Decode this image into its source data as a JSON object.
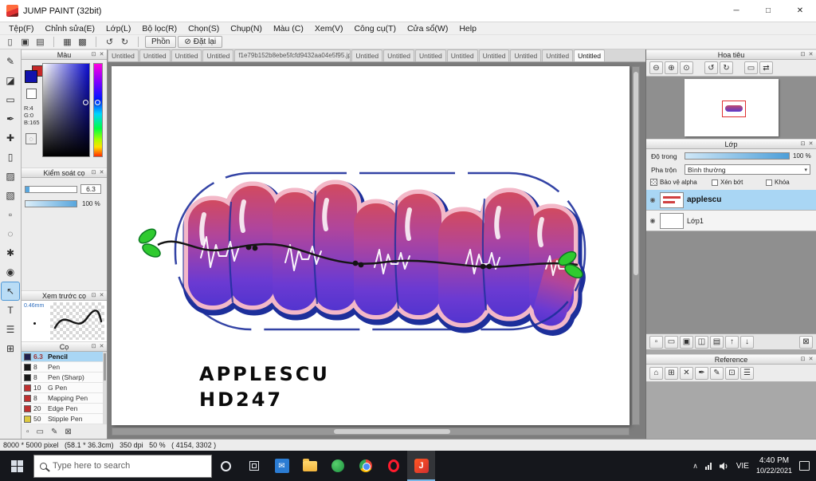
{
  "titlebar": {
    "title": "JUMP PAINT (32bit)"
  },
  "menubar": {
    "items": [
      "Tệp(F)",
      "Chỉnh sửa(E)",
      "Lớp(L)",
      "Bộ lọc(R)",
      "Chọn(S)",
      "Chụp(N)",
      "Màu (C)",
      "Xem(V)",
      "Công cụ(T)",
      "Cửa sổ(W)",
      "Help"
    ]
  },
  "toolbar": {
    "brush_button": "Phồn",
    "reset_button": "Đặt lại"
  },
  "tabs": {
    "items": [
      "Untitled",
      "Untitled",
      "Untitled",
      "Untitled",
      "f1e79b152b8ebe5fcfd9432aa04e5f95.jpg",
      "Untitled",
      "Untitled",
      "Untitled",
      "Untitled",
      "Untitled",
      "Untitled",
      "Untitled",
      "Untitled"
    ],
    "active_index": 12
  },
  "color_panel": {
    "title": "Màu",
    "r_label": "R:4",
    "g_label": "G:0",
    "b_label": "B:165"
  },
  "brush_control_panel": {
    "title": "Kiểm soát cọ",
    "size_value": "6.3",
    "opacity_value": "100 %"
  },
  "brush_preview_panel": {
    "title": "Xem trước cọ",
    "tip_size": "0.46mm"
  },
  "brush_panel": {
    "title": "Cọ",
    "selected_index": 0,
    "brushes": [
      {
        "size": "6.3",
        "name": "Pencil"
      },
      {
        "size": "8",
        "name": "Pen"
      },
      {
        "size": "8",
        "name": "Pen (Sharp)"
      },
      {
        "size": "10",
        "name": "G Pen"
      },
      {
        "size": "8",
        "name": "Mapping Pen"
      },
      {
        "size": "20",
        "name": "Edge Pen"
      },
      {
        "size": "50",
        "name": "Stipple Pen"
      }
    ]
  },
  "navigator_panel": {
    "title": "Hoa tiêu"
  },
  "layers_panel": {
    "title": "Lớp",
    "opacity_label": "Độ trong",
    "opacity_value": "100 %",
    "blend_label": "Pha trộn",
    "blend_value": "Bình thường",
    "alpha_protect_label": "Bảo vệ alpha",
    "clipping_label": "Xén bớt",
    "lock_label": "Khóa",
    "selected_index": 0,
    "layers": [
      {
        "name": "applescu"
      },
      {
        "name": "Lớp1"
      }
    ]
  },
  "reference_panel": {
    "title": "Reference"
  },
  "canvas": {
    "artwork_line1": "APPLESCU",
    "artwork_line2": "HD247"
  },
  "statusbar": {
    "info": "8000 * 5000 pixel   (58.1 * 36.3cm)   350 dpi   50 %   ( 4154, 3302 )"
  },
  "taskbar": {
    "search_placeholder": "Type here to search",
    "language": "VIE",
    "time": "4:40 PM",
    "date": "10/22/2021"
  },
  "colors": {
    "selection_highlight": "#a9d6f4",
    "foreground_color": "#1313ad",
    "letters_gradient_top": "#d14a60",
    "letters_gradient_bottom": "#5334cf",
    "outline_navy": "#1d2f9b",
    "halo_pink": "#f3b8c8",
    "leaf_green": "#2fca2f",
    "taskbar_bg": "#15171c"
  },
  "icons": {
    "win_min": "─",
    "win_max": "□",
    "win_close": "✕",
    "tb_new": "▯",
    "tb_save": "▣",
    "tb_open": "▤",
    "tb_snap": "▦",
    "tb_grid": "▩",
    "tb_undo": "↺",
    "tb_redo": "↻",
    "tb_reset": "⊘",
    "panel_pop": "⊡",
    "panel_close": "✕",
    "tool_brush": "✎",
    "tool_eraser": "◪",
    "tool_marquee": "▭",
    "tool_pen": "✒",
    "tool_move": "✚",
    "tool_shape": "▯",
    "tool_fill": "▨",
    "tool_gradient": "▧",
    "tool_selectpen": "▫",
    "tool_lasso": "◌",
    "tool_wand": "✱",
    "tool_eyedropper": "◉",
    "tool_operation": "↖",
    "tool_text": "T",
    "tool_hand": "☰",
    "tool_divide": "⊞",
    "transparent": "◌",
    "nav_zoom_out": "⊖",
    "nav_zoom_in": "⊕",
    "nav_zoom_fit": "⊙",
    "nav_rotate_ccw": "↺",
    "nav_rotate_cw": "↻",
    "nav_reset": "▭",
    "nav_flip": "⇄",
    "dropdown": "▾",
    "eye": "◉",
    "layer_add": "▫",
    "layer_folder": "▭",
    "layer_duplicate": "▣",
    "layer_mask": "◫",
    "layer_merge": "▤",
    "layer_up": "↑",
    "layer_down": "↓",
    "layer_delete": "⊠",
    "ref_home": "⌂",
    "ref_grid": "⊞",
    "ref_close": "✕",
    "ref_pick": "✒",
    "ref_pen": "✎",
    "ref_zoom": "⊡",
    "ref_menu": "☰",
    "brush_add": "▫",
    "brush_folder": "▭",
    "brush_edit": "✎",
    "brush_delete": "⊠",
    "tray_chevron": "∧",
    "mail": "✉",
    "jump_logo": "J"
  }
}
